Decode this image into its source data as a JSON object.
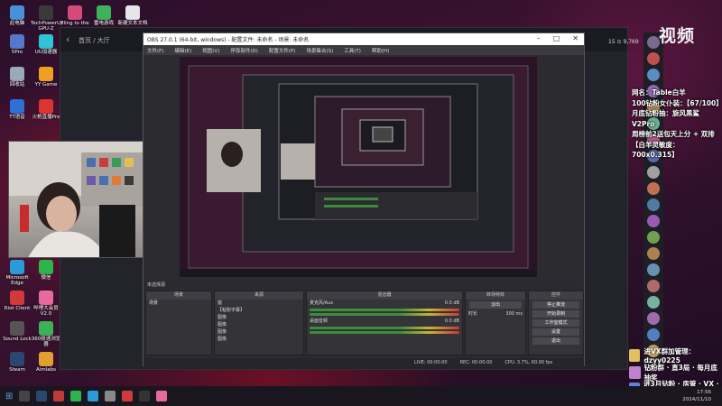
{
  "desktop": {
    "icons": [
      {
        "label": "此电脑",
        "color": "#4a90d9"
      },
      {
        "label": "TechPowerUp GPU-Z",
        "color": "#3a3a3a"
      },
      {
        "label": "Fling to the",
        "color": "#d64a7a"
      },
      {
        "label": "雷电游戏",
        "color": "#3fb15a"
      },
      {
        "label": "新建文本文档",
        "color": "#e6e6e6"
      },
      {
        "label": "5Pro",
        "color": "#5577cc"
      },
      {
        "label": "UU加速器",
        "color": "#2ec4d6"
      },
      {
        "label": "回收站",
        "color": "#9ab"
      },
      {
        "label": "YY Game",
        "color": "#f0a020"
      },
      {
        "label": "TT语音",
        "color": "#2f6fd8"
      },
      {
        "label": "火枪直播Pro",
        "color": "#d33"
      },
      {
        "label": "Microsoft Edge",
        "color": "#2a9ad8"
      },
      {
        "label": "微信",
        "color": "#2bb54a"
      },
      {
        "label": "Riot Client",
        "color": "#d23a3a"
      },
      {
        "label": "哔哩大会员V2.0",
        "color": "#e86a9c"
      },
      {
        "label": "Sound Lock",
        "color": "#555"
      },
      {
        "label": "360极速浏览器",
        "color": "#3db05a"
      },
      {
        "label": "Steam",
        "color": "#2a4770"
      },
      {
        "label": "Aimlabs",
        "color": "#e0a030"
      }
    ]
  },
  "shell": {
    "back_icon": "chevron-left-icon",
    "breadcrumb": "首页 / 大厅"
  },
  "obs": {
    "title": "OBS 27.0.1 (64-bit, windows) - 配置文件: 未命名 - 场景: 未命名",
    "menu": [
      "文件(F)",
      "编辑(E)",
      "视图(V)",
      "停靠部件(D)",
      "配置文件(P)",
      "场景集合(S)",
      "工具(T)",
      "帮助(H)"
    ],
    "status_text": "未选择源",
    "docks": {
      "scenes": {
        "title": "场景",
        "items": [
          "场景"
        ]
      },
      "sources": {
        "title": "来源",
        "items": [
          "窗",
          "【粘粉字幕】",
          "图像",
          "图像",
          "图像",
          "图像"
        ]
      },
      "mixer": {
        "title": "混音器",
        "tracks": [
          {
            "name": "麦克风/Aux",
            "db": "0.0 dB"
          },
          {
            "name": "桌面音频",
            "db": "0.0 dB"
          }
        ]
      },
      "transitions": {
        "title": "转场特效",
        "type": "淡出",
        "duration_label": "时长",
        "duration": "300 ms"
      },
      "controls": {
        "title": "控件",
        "buttons": [
          "停止推流",
          "开始录制",
          "工作室模式",
          "设置",
          "退出"
        ]
      }
    },
    "statusbar": {
      "live": "LIVE: 00:00:00",
      "rec": "REC: 00:00:00",
      "cpu": "CPU: 3.7%, 60.00 fps"
    }
  },
  "overlay": {
    "lines": [
      "网名：Table白羊",
      "100钻粉女仆装：【67/100】",
      "月底钻粉抽：旋风黑鲨V2Pro",
      "周榜前2送包天上分 + 双排",
      "【白羊灵敏度：700x0.315】"
    ],
    "brand": "视频",
    "top_info": "15  ⊙ 9,769"
  },
  "danmaku": [
    {
      "text": "进VX群加管理：dzyy0225"
    },
    {
      "text": "钻粉群 · 直3局 · 每月底抽奖"
    },
    {
      "text": "进3月钻粉 · 房管 · VX · 床位"
    }
  ],
  "clock": {
    "time": "17:56",
    "date": "2024/11/10"
  },
  "colors": {
    "accent": "#c03a3a",
    "meter_green": "#3c8c3c",
    "meter_yellow": "#c9b430"
  }
}
